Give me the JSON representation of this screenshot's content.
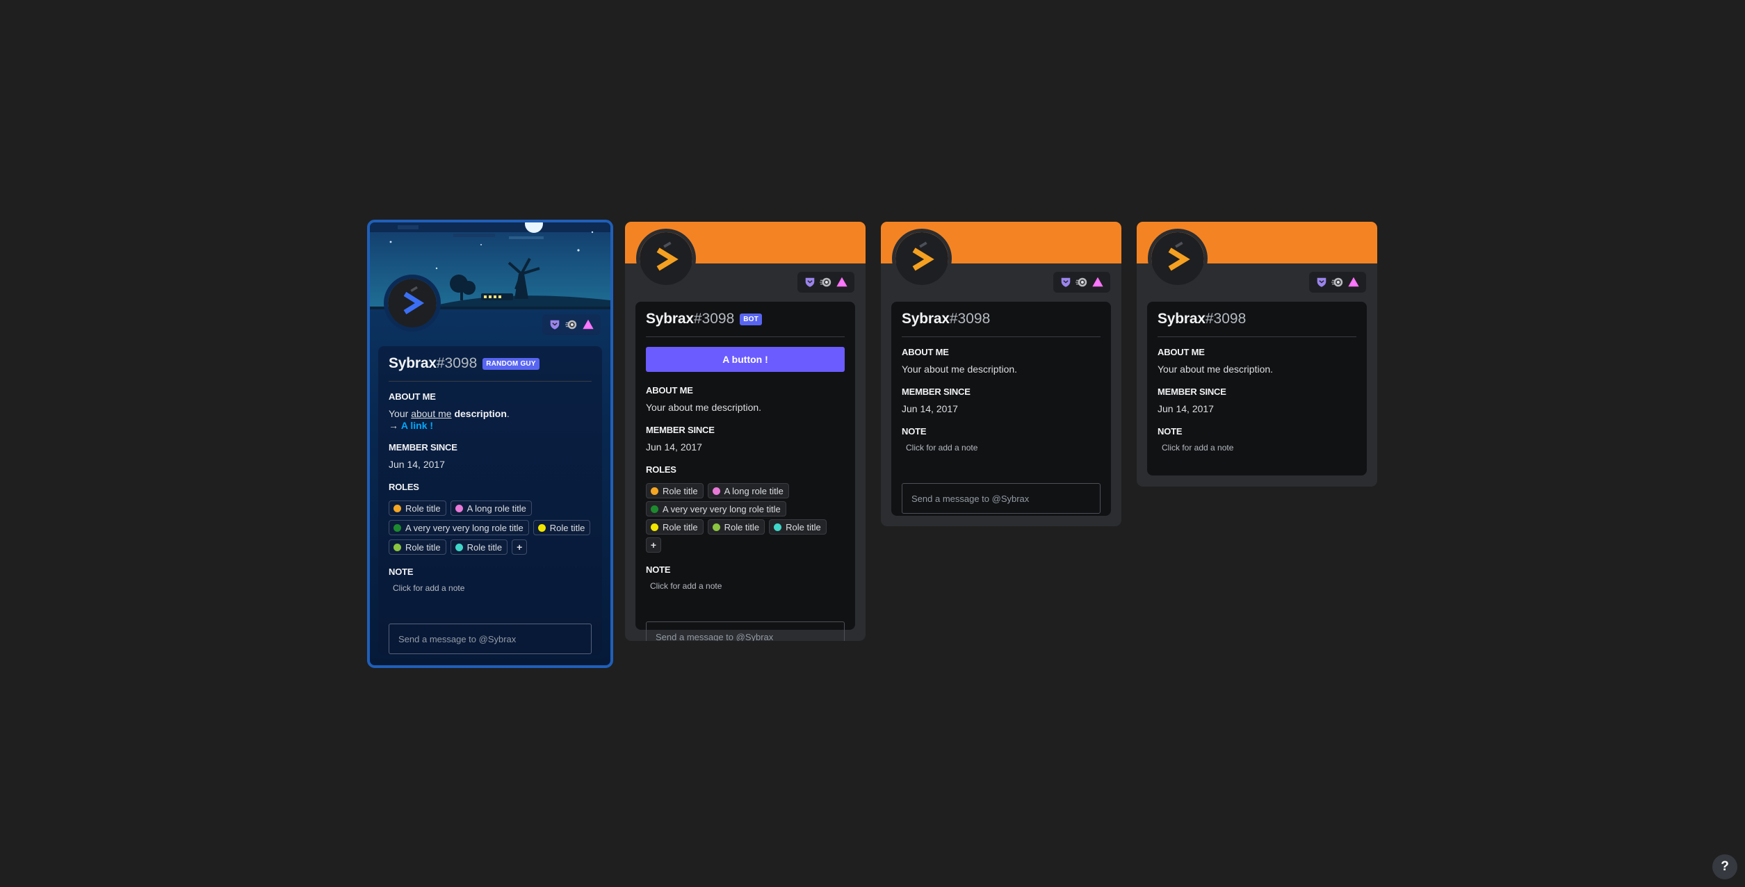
{
  "colors": {
    "page_bg": "#1f1f1f",
    "card_bg": "#2b2d31",
    "inner_bg": "#111214",
    "banner_orange": "#f48423",
    "themed_border": "#1f5fb8",
    "bot_tag": "#5865f2",
    "button": "#6b5cff",
    "link": "#00a8fc"
  },
  "icons": {
    "avatar": "chevron-logo",
    "badges": [
      "hypesquad-shield-icon",
      "nitro-orb-icon",
      "triangle-badge-icon"
    ],
    "help": "question-icon"
  },
  "cards": [
    {
      "username": "Sybrax",
      "discriminator": "#3098",
      "tag": "RANDOM GUY",
      "about_heading": "ABOUT ME",
      "about_pre": "Your ",
      "about_link": "about me",
      "about_bold": "description",
      "about_post": ".",
      "about_arrow": "→",
      "about_link2": "A link !",
      "member_heading": "MEMBER SINCE",
      "member_since": "Jun 14, 2017",
      "roles_heading": "ROLES",
      "roles": [
        {
          "label": "Role title",
          "color": "#f5a623"
        },
        {
          "label": "A long role title",
          "color": "#e879d6"
        },
        {
          "label": "A very very very long role title",
          "color": "#1e8a2e"
        },
        {
          "label": "Role title",
          "color": "#f2e600"
        },
        {
          "label": "Role title",
          "color": "#8bc53f"
        },
        {
          "label": "Role title",
          "color": "#3fd6c8"
        }
      ],
      "role_add": "+",
      "note_heading": "NOTE",
      "note_placeholder": "Click for add a note",
      "message_placeholder": "Send a message to @Sybrax"
    },
    {
      "username": "Sybrax",
      "discriminator": "#3098",
      "tag": "BOT",
      "button_label": "A button !",
      "about_heading": "ABOUT ME",
      "about_text": "Your about me description.",
      "member_heading": "MEMBER SINCE",
      "member_since": "Jun 14, 2017",
      "roles_heading": "ROLES",
      "roles": [
        {
          "label": "Role title",
          "color": "#f5a623"
        },
        {
          "label": "A long role title",
          "color": "#e879d6"
        },
        {
          "label": "A very very very long role title",
          "color": "#1e8a2e"
        },
        {
          "label": "Role title",
          "color": "#f2e600"
        },
        {
          "label": "Role title",
          "color": "#8bc53f"
        },
        {
          "label": "Role title",
          "color": "#3fd6c8"
        }
      ],
      "role_add": "+",
      "note_heading": "NOTE",
      "note_placeholder": "Click for add a note",
      "message_placeholder": "Send a message to @Sybrax"
    },
    {
      "username": "Sybrax",
      "discriminator": "#3098",
      "about_heading": "ABOUT ME",
      "about_text": "Your about me description.",
      "member_heading": "MEMBER SINCE",
      "member_since": "Jun 14, 2017",
      "note_heading": "NOTE",
      "note_placeholder": "Click for add a note",
      "message_placeholder": "Send a message to @Sybrax"
    },
    {
      "username": "Sybrax",
      "discriminator": "#3098",
      "about_heading": "ABOUT ME",
      "about_text": "Your about me description.",
      "member_heading": "MEMBER SINCE",
      "member_since": "Jun 14, 2017",
      "note_heading": "NOTE",
      "note_placeholder": "Click for add a note"
    }
  ],
  "help_label": "?"
}
